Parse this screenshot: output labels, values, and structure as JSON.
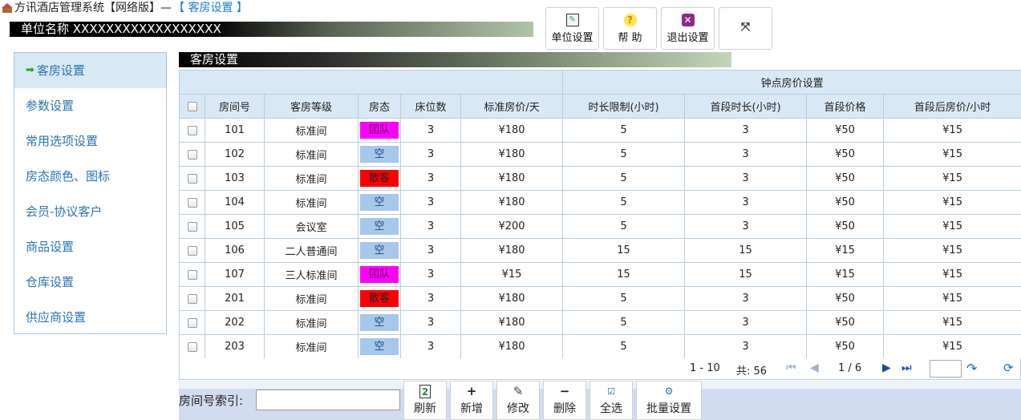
{
  "app": {
    "title": "方讯酒店管理系统【网络版】—",
    "section": "【 客房设置 】",
    "unit_name": "单位名称 XXXXXXXXXXXXXXXXXX"
  },
  "toolbar": {
    "unit_settings": "单位设置",
    "help": "帮 助",
    "exit_settings": "退出设置"
  },
  "sidebar": {
    "items": [
      {
        "label": "客房设置"
      },
      {
        "label": "参数设置"
      },
      {
        "label": "常用选项设置"
      },
      {
        "label": "房态颜色、图标"
      },
      {
        "label": "会员-协议客户"
      },
      {
        "label": "商品设置"
      },
      {
        "label": "仓库设置"
      },
      {
        "label": "供应商设置"
      }
    ]
  },
  "panel": {
    "title": "客房设置",
    "group_header": "钟点房价设置",
    "columns": [
      "房间号",
      "客房等级",
      "房态",
      "床位数",
      "标准房价/天",
      "时长限制(小时)",
      "首段时长(小时)",
      "首段价格",
      "首段后房价/小时"
    ]
  },
  "colors": {
    "status_team": "#ff00ff",
    "status_empty": "#a6c8ea",
    "status_walkin": "#ff0000",
    "header_bg": "#d8e8f6",
    "link": "#1a7bd0"
  },
  "rows": [
    {
      "room": "101",
      "grade": "标准间",
      "status": "团队",
      "status_type": "team",
      "beds": "3",
      "price": "¥180",
      "limit": "5",
      "first_hours": "3",
      "first_price": "¥50",
      "after_price": "¥15"
    },
    {
      "room": "102",
      "grade": "标准间",
      "status": "空",
      "status_type": "empty",
      "beds": "3",
      "price": "¥180",
      "limit": "5",
      "first_hours": "3",
      "first_price": "¥50",
      "after_price": "¥15"
    },
    {
      "room": "103",
      "grade": "标准间",
      "status": "散客",
      "status_type": "walk",
      "beds": "3",
      "price": "¥180",
      "limit": "5",
      "first_hours": "3",
      "first_price": "¥50",
      "after_price": "¥15"
    },
    {
      "room": "104",
      "grade": "标准间",
      "status": "空",
      "status_type": "empty",
      "beds": "3",
      "price": "¥180",
      "limit": "5",
      "first_hours": "3",
      "first_price": "¥50",
      "after_price": "¥15"
    },
    {
      "room": "105",
      "grade": "会议室",
      "status": "空",
      "status_type": "empty",
      "beds": "3",
      "price": "¥200",
      "limit": "5",
      "first_hours": "3",
      "first_price": "¥50",
      "after_price": "¥15"
    },
    {
      "room": "106",
      "grade": "二人普通间",
      "status": "空",
      "status_type": "empty",
      "beds": "3",
      "price": "¥180",
      "limit": "15",
      "first_hours": "15",
      "first_price": "¥15",
      "after_price": "¥15"
    },
    {
      "room": "107",
      "grade": "三人标准间",
      "status": "团队",
      "status_type": "team",
      "beds": "3",
      "price": "¥15",
      "limit": "15",
      "first_hours": "15",
      "first_price": "¥15",
      "after_price": "¥15"
    },
    {
      "room": "201",
      "grade": "标准间",
      "status": "散客",
      "status_type": "walk",
      "beds": "3",
      "price": "¥180",
      "limit": "5",
      "first_hours": "3",
      "first_price": "¥50",
      "after_price": "¥15"
    },
    {
      "room": "202",
      "grade": "标准间",
      "status": "空",
      "status_type": "empty",
      "beds": "3",
      "price": "¥180",
      "limit": "5",
      "first_hours": "3",
      "first_price": "¥50",
      "after_price": "¥15"
    },
    {
      "room": "203",
      "grade": "标准间",
      "status": "空",
      "status_type": "empty",
      "beds": "3",
      "price": "¥180",
      "limit": "5",
      "first_hours": "3",
      "first_price": "¥50",
      "after_price": "¥15"
    }
  ],
  "pager": {
    "range": "1 - 10",
    "total": "共: 56",
    "page": "1 / 6"
  },
  "bottom": {
    "search_label": "房间号索引:",
    "refresh": "刷新",
    "add": "新增",
    "edit": "修改",
    "delete": "删除",
    "select_all": "全选",
    "batch": "批量设置"
  }
}
